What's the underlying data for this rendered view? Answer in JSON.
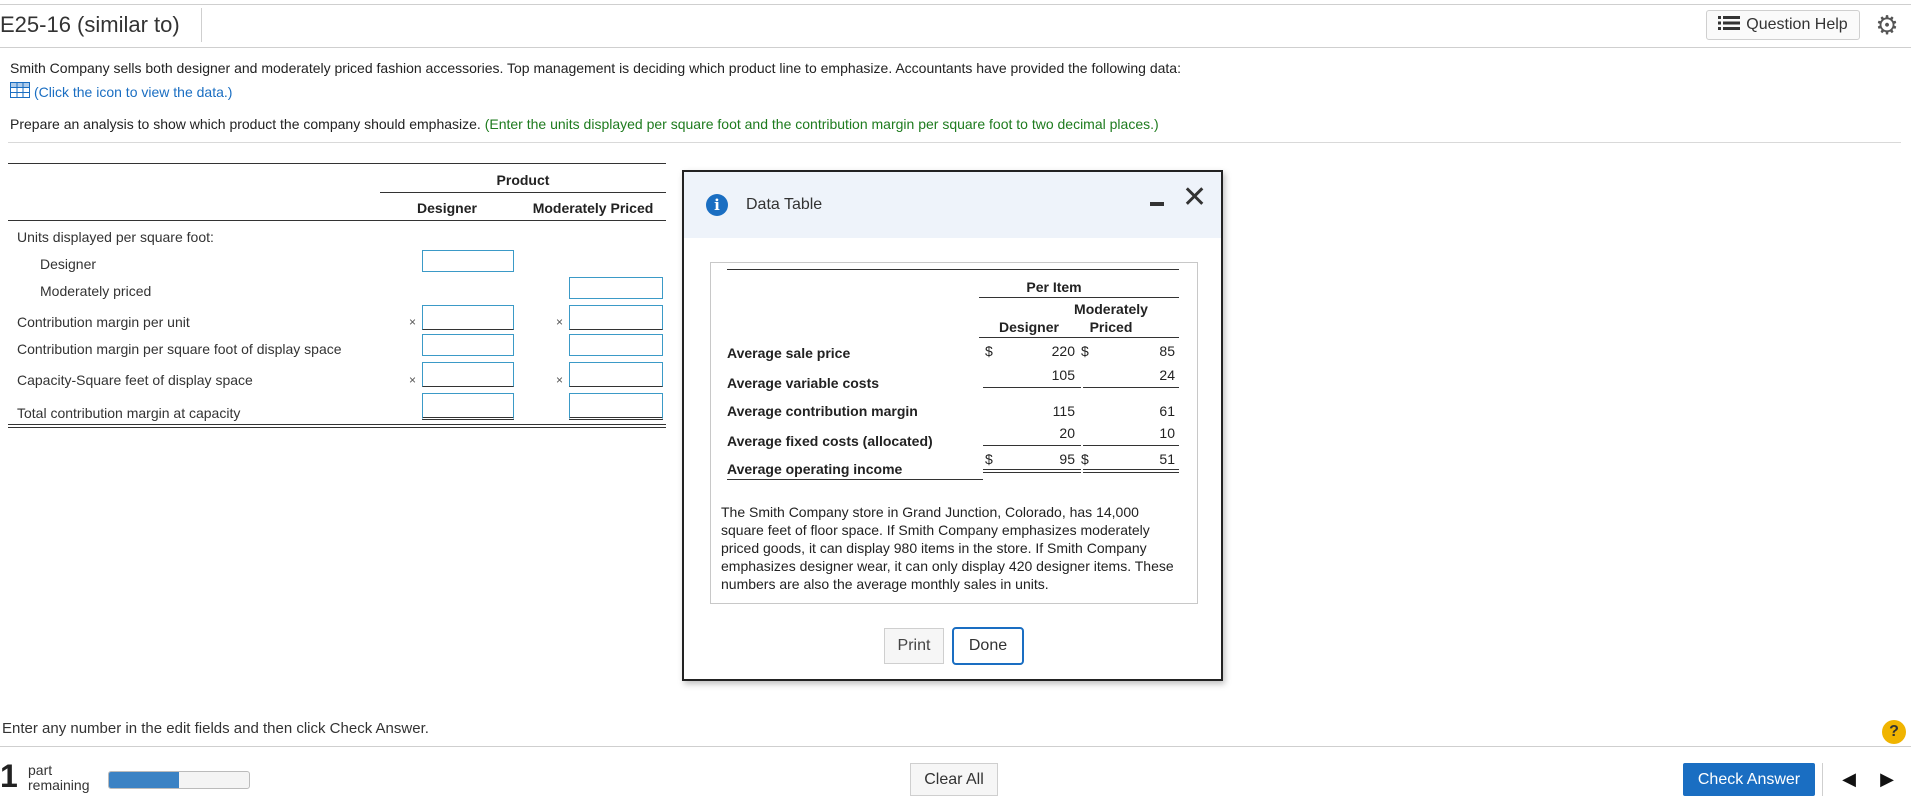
{
  "header": {
    "title": "E25-16 (similar to)",
    "question_help": "Question Help",
    "help_icon": "list-icon",
    "settings_icon": "gear-icon"
  },
  "question": {
    "intro": "Smith Company sells both designer and moderately priced fashion accessories. Top management is deciding which product line to emphasize. Accountants have provided the following data:",
    "data_link": "(Click the icon to view the data.)",
    "prepare": "Prepare an analysis to show which product the company should emphasize.",
    "hint": "(Enter the units displayed per square foot and the contribution margin per square foot to two decimal places.)"
  },
  "analysis": {
    "product_header": "Product",
    "col_designer": "Designer",
    "col_moderate": "Moderately Priced",
    "rows": {
      "units_header": "Units displayed per square foot:",
      "designer": "Designer",
      "moderate": "Moderately priced",
      "cm_unit": "Contribution margin per unit",
      "cm_sqft": "Contribution margin per square foot of display space",
      "capacity": "Capacity-Square feet of display space",
      "total": "Total contribution margin at capacity"
    },
    "times": "×"
  },
  "dialog": {
    "title": "Data Table",
    "per_item": "Per Item",
    "col_designer": "Designer",
    "col_moderate_1": "Moderately",
    "col_moderate_2": "Priced",
    "rows": [
      {
        "label": "Average sale price",
        "cur1": "$",
        "designer": "220",
        "cur2": "$",
        "moderate": "85"
      },
      {
        "label": "Average variable costs",
        "cur1": "",
        "designer": "105",
        "cur2": "",
        "moderate": "24"
      },
      {
        "label": "Average contribution margin",
        "cur1": "",
        "designer": "115",
        "cur2": "",
        "moderate": "61"
      },
      {
        "label": "Average fixed costs (allocated)",
        "cur1": "",
        "designer": "20",
        "cur2": "",
        "moderate": "10"
      },
      {
        "label": "Average operating income",
        "cur1": "$",
        "designer": "95",
        "cur2": "$",
        "moderate": "51"
      }
    ],
    "note": "The Smith Company store in Grand Junction, Colorado, has 14,000 square feet of floor space. If Smith Company emphasizes moderately priced goods, it can display 980 items in the store. If Smith Company emphasizes designer wear, it can only display 420 designer items. These numbers are also the average monthly sales in units.",
    "print": "Print",
    "done": "Done"
  },
  "footer": {
    "enter_any": "Enter any number in the edit fields and then click Check Answer.",
    "part_number": "1",
    "part_word": "part",
    "remaining_word": "remaining",
    "progress_fraction": 0.5,
    "clear_all": "Clear All",
    "check_answer": "Check Answer",
    "help_symbol": "?"
  }
}
